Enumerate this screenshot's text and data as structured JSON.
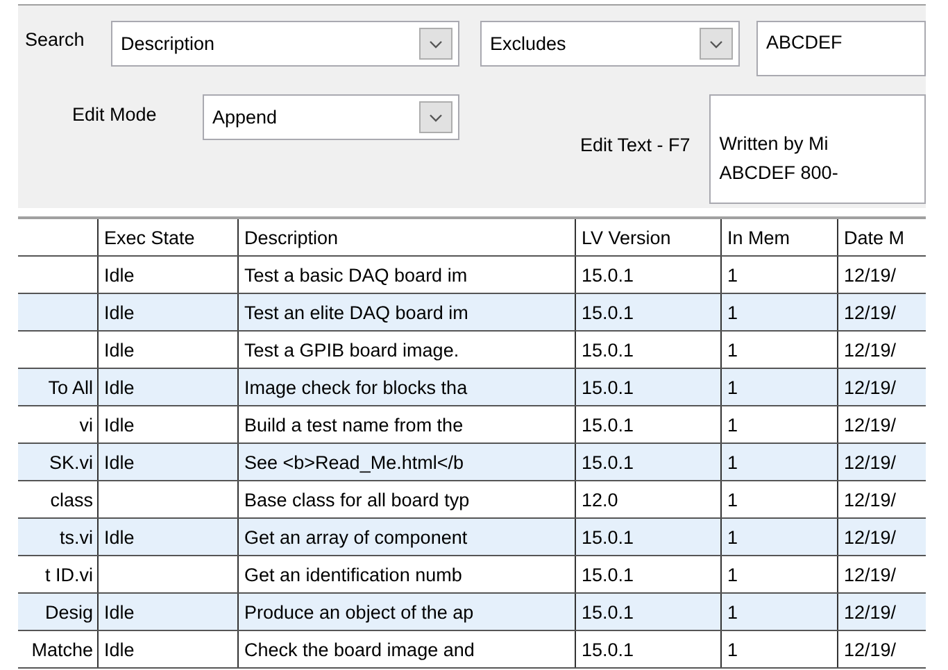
{
  "search": {
    "label": "Search",
    "field": "Description",
    "operator": "Excludes",
    "value": "ABCDEF"
  },
  "edit": {
    "mode_label": "Edit Mode",
    "mode": "Append",
    "text_label": "Edit Text - F7",
    "text_lines": [
      "Written by Mi",
      "ABCDEF 800-"
    ]
  },
  "table": {
    "columns": [
      "",
      "Exec State",
      "Description",
      "LV Version",
      "In Mem",
      "Date M"
    ],
    "rows": [
      [
        "",
        "Idle",
        "Test a basic DAQ board im",
        "15.0.1",
        "1",
        "12/19/"
      ],
      [
        "",
        "Idle",
        "Test an elite DAQ board im",
        "15.0.1",
        "1",
        "12/19/"
      ],
      [
        "",
        "Idle",
        "Test a GPIB board image.",
        "15.0.1",
        "1",
        "12/19/"
      ],
      [
        "To All",
        "Idle",
        "Image check for blocks tha",
        "15.0.1",
        "1",
        "12/19/"
      ],
      [
        "vi",
        "Idle",
        "Build a test name from the",
        "15.0.1",
        "1",
        "12/19/"
      ],
      [
        "SK.vi",
        "Idle",
        "See <b>Read_Me.html</b",
        "15.0.1",
        "1",
        "12/19/"
      ],
      [
        "class",
        "",
        "Base class for all board typ",
        "12.0",
        "1",
        "12/19/"
      ],
      [
        "ts.vi",
        "Idle",
        "Get an array of component",
        "15.0.1",
        "1",
        "12/19/"
      ],
      [
        "t ID.vi",
        "",
        "Get an identification numb",
        "15.0.1",
        "1",
        "12/19/"
      ],
      [
        "Desig",
        "Idle",
        "Produce an object of the ap",
        "15.0.1",
        "1",
        "12/19/"
      ],
      [
        "Matche",
        "Idle",
        "Check the board image and",
        "15.0.1",
        "1",
        "12/19/"
      ]
    ]
  }
}
